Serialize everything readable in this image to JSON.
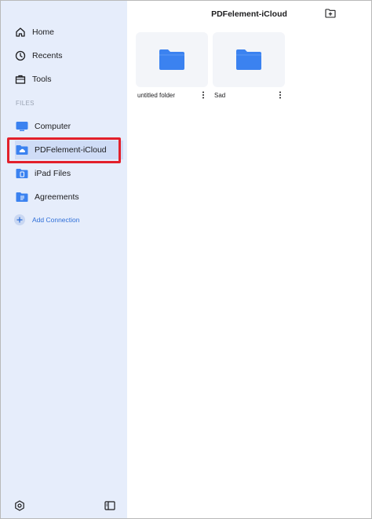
{
  "sidebar": {
    "nav": [
      {
        "label": "Home",
        "icon": "home-icon"
      },
      {
        "label": "Recents",
        "icon": "clock-icon"
      },
      {
        "label": "Tools",
        "icon": "toolbox-icon"
      }
    ],
    "section_label": "FILES",
    "files": [
      {
        "label": "Computer",
        "icon": "monitor-icon"
      },
      {
        "label": "PDFelement-iCloud",
        "icon": "cloud-folder-icon",
        "selected": true
      },
      {
        "label": "iPad Files",
        "icon": "ipad-folder-icon"
      },
      {
        "label": "Agreements",
        "icon": "document-folder-icon"
      }
    ],
    "add_connection": "Add Connection"
  },
  "header": {
    "title": "PDFelement-iCloud"
  },
  "folders": [
    {
      "name": "untitled folder"
    },
    {
      "name": "Sad"
    }
  ],
  "colors": {
    "sidebar_bg": "#e6edfb",
    "accent": "#2f6fd8",
    "folder_blue": "#3b82f0",
    "highlight_red": "#e2202b"
  }
}
